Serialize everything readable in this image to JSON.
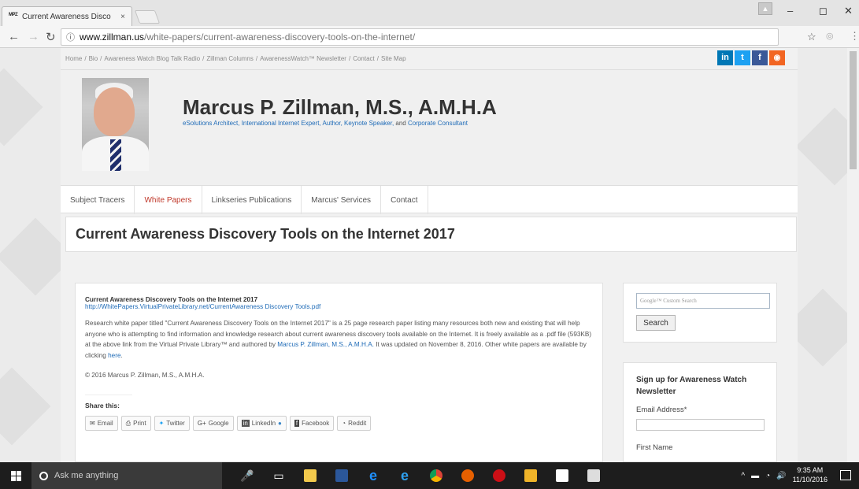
{
  "browser": {
    "tab_title": "Current Awareness Disco",
    "favicon_text": "MPZ",
    "tab_close": "×",
    "url_host": "www.zillman.us",
    "url_path": "/white-papers/current-awareness-discovery-tools-on-the-internet/",
    "window_min": "–",
    "window_max": "◻",
    "window_close": "✕"
  },
  "topnav": {
    "items": [
      "Home",
      "Bio",
      "Awareness Watch Blog Talk Radio",
      "Zillman Columns",
      "AwarenessWatch™ Newsletter",
      "Contact",
      "Site Map"
    ],
    "separator": "/"
  },
  "social": {
    "linkedin": "in",
    "twitter": "🐦",
    "facebook": "f",
    "rss": "ॐ"
  },
  "header": {
    "name": "Marcus P. Zillman, M.S., A.M.H.A",
    "tagline_links": "eSolutions Architect, International Internet Expert, Author, Keynote Speaker,",
    "tagline_and": " and ",
    "tagline_last": "Corporate Consultant"
  },
  "menu": {
    "items": [
      "Subject Tracers",
      "White Papers",
      "Linkseries Publications",
      "Marcus' Services",
      "Contact"
    ],
    "active_index": 1
  },
  "page_title": "Current Awareness Discovery Tools on the Internet 2017",
  "article": {
    "title": "Current Awareness Discovery Tools on the Internet 2017",
    "link": "http://WhitePapers.VirtualPrivateLibrary.net/CurrentAwareness Discovery Tools.pdf",
    "body_1": "Research white paper titled \"Current Awareness Discovery Tools on the Internet 2017\" is a 25 page research paper listing many resources both new and existing that will help anyone who is attempting to find information and knowledge research about current awareness discovery tools available on the Internet. It is freely available as a .pdf file (593KB) at the above link from the Virtual Private Library™ and authored by ",
    "author_link": "Marcus P. Zillman, M.S., A.M.H.A.",
    "body_2": " It was updated on November 8, 2016. Other white papers are available by clicking ",
    "here_link": "here",
    "body_3": ".",
    "copyright": "© 2016 Marcus P. Zillman, M.S., A.M.H.A.",
    "share_label": "Share this:",
    "share_buttons": [
      {
        "icon": "✉",
        "label": "Email"
      },
      {
        "icon": "🖶",
        "label": "Print"
      },
      {
        "icon": "🐦",
        "label": "Twitter"
      },
      {
        "icon": "G+",
        "label": "Google"
      },
      {
        "icon": "in",
        "label": "LinkedIn"
      },
      {
        "icon": "f",
        "label": "Facebook"
      },
      {
        "icon": "◔",
        "label": "Reddit"
      }
    ]
  },
  "sidebar": {
    "search_placeholder": "Google™ Custom Search",
    "search_button": "Search",
    "newsletter_heading": "Sign up for Awareness Watch Newsletter",
    "email_label": "Email Address*",
    "first_name_label": "First Name"
  },
  "taskbar": {
    "search_text": "Ask me anything",
    "time": "9:35 AM",
    "date": "11/10/2016"
  },
  "colors": {
    "linkedin": "#0077b5",
    "twitter": "#1da1f2",
    "facebook": "#3b5998",
    "rss": "#f26522",
    "link": "#1f6bb7",
    "active_menu": "#c0392b"
  }
}
